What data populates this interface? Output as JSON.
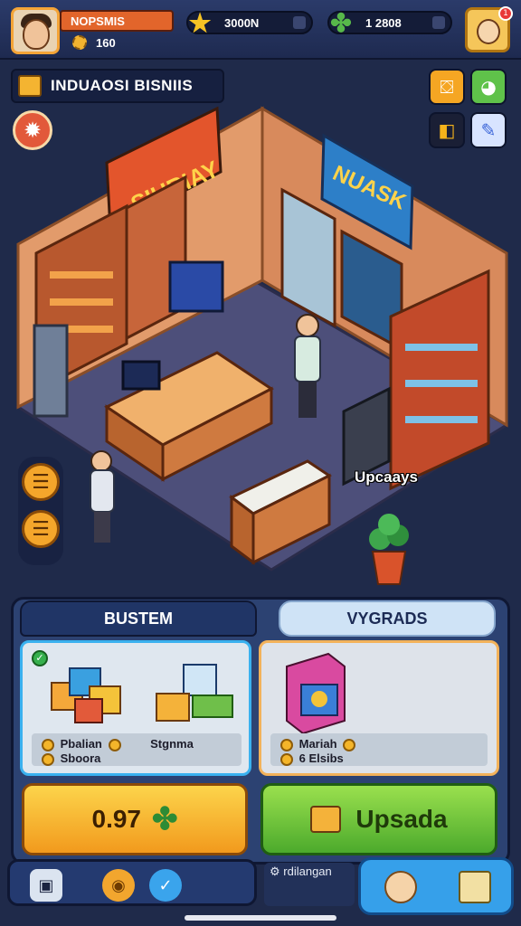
{
  "hud": {
    "player_name": "NOPSMIS",
    "player_level": "160",
    "currency_1": "3000N",
    "currency_2": "1 2808",
    "notif_count": "1"
  },
  "banner": {
    "title": "INDUAOSI BISNIIS"
  },
  "scene": {
    "sign_left": "SIURIAY",
    "sign_right": "NUASK",
    "upgrade_label": "Upcaays"
  },
  "tabs": {
    "left": "BUSTEM",
    "right": "VYGRADS"
  },
  "cards": {
    "left": {
      "line1_a": "Pbalian",
      "line1_b": "Stgnma",
      "line2": "Sboora"
    },
    "right": {
      "line1": "Mariah",
      "line2": "6 Elsibs"
    }
  },
  "buttons": {
    "price": "0.97",
    "upgrade": "Upsada"
  },
  "footer": {
    "mid_label": "rdilangan"
  },
  "colors": {
    "accent": "#3ab1ef",
    "upgrade": "#4caa2c",
    "price": "#f29a1d"
  }
}
